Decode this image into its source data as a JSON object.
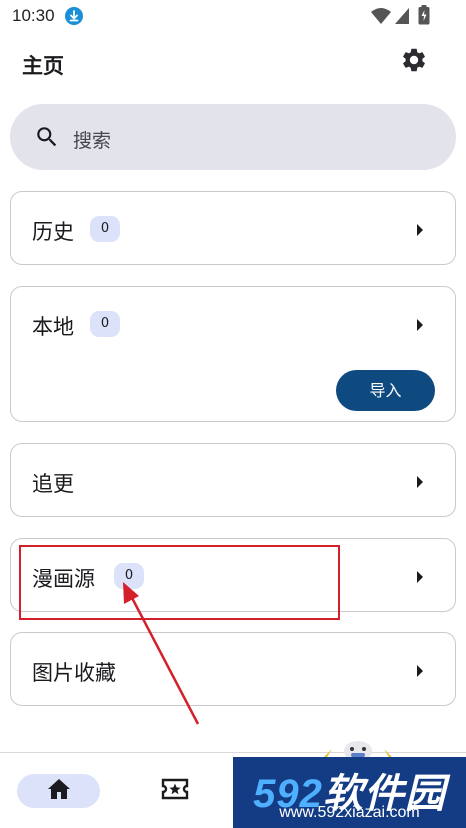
{
  "status_bar": {
    "time": "10:30",
    "icons": [
      "download-icon",
      "wifi-icon",
      "signal-icon",
      "battery-icon"
    ]
  },
  "header": {
    "title": "主页",
    "settings_icon": "gear-icon"
  },
  "search": {
    "placeholder": "搜索"
  },
  "sections": [
    {
      "label": "历史",
      "count": "0"
    },
    {
      "label": "本地",
      "count": "0",
      "action_label": "导入"
    },
    {
      "label": "追更"
    },
    {
      "label": "漫画源",
      "count": "0"
    },
    {
      "label": "图片收藏"
    }
  ],
  "bottom_nav": {
    "items": [
      {
        "icon": "home-icon",
        "selected": true
      },
      {
        "icon": "ticket-star-icon",
        "selected": false
      }
    ]
  },
  "watermark": {
    "brand_num": "592",
    "brand_text": "软件园",
    "url": "www.592xiazai.com"
  },
  "colors": {
    "accent": "#0e4a80",
    "badge_bg": "#dce2f9",
    "search_bg": "#e3e4eb",
    "annotation": "#d4202a",
    "watermark_bg": "#143c84"
  }
}
